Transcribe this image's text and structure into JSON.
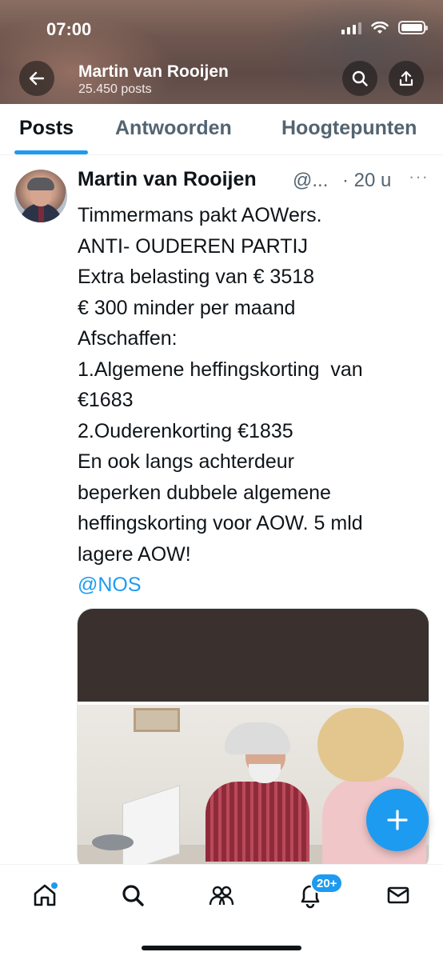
{
  "status_bar": {
    "time": "07:00",
    "icons": [
      "signal-icon",
      "wifi-icon",
      "battery-icon"
    ]
  },
  "header": {
    "title": "Martin van Rooijen",
    "subtitle": "25.450 posts",
    "icons": [
      "back-arrow-icon",
      "search-icon",
      "share-icon"
    ]
  },
  "tabs": [
    {
      "label": "Posts",
      "active": true
    },
    {
      "label": "Antwoorden",
      "active": false
    },
    {
      "label": "Hoogtepunten",
      "active": false
    }
  ],
  "post": {
    "name": "Martin van Rooijen",
    "handle": "@...",
    "time": "· 20 u",
    "more": "···",
    "lines": [
      "Timmermans pakt AOWers.",
      "ANTI- OUDEREN PARTIJ",
      "Extra belasting van € 3518",
      "€ 300 minder per maand",
      "Afschaffen:",
      "1.Algemene heffingskorting  van",
      "€1683",
      "2.Ouderenkorting €1835",
      "En ook langs achterdeur",
      "beperken dubbele algemene",
      "heffingskorting voor AOW. 5 mld",
      "lagere AOW!"
    ],
    "mention": "@NOS"
  },
  "fab": {
    "icon": "plus-icon"
  },
  "bottom_nav": {
    "items": [
      "home-icon",
      "search-icon",
      "communities-icon",
      "notifications-icon",
      "messages-icon"
    ],
    "notifications_badge": "20+"
  },
  "colors": {
    "accent": "#1d9bf0",
    "text": "#0f1419",
    "secondary": "#536471"
  }
}
